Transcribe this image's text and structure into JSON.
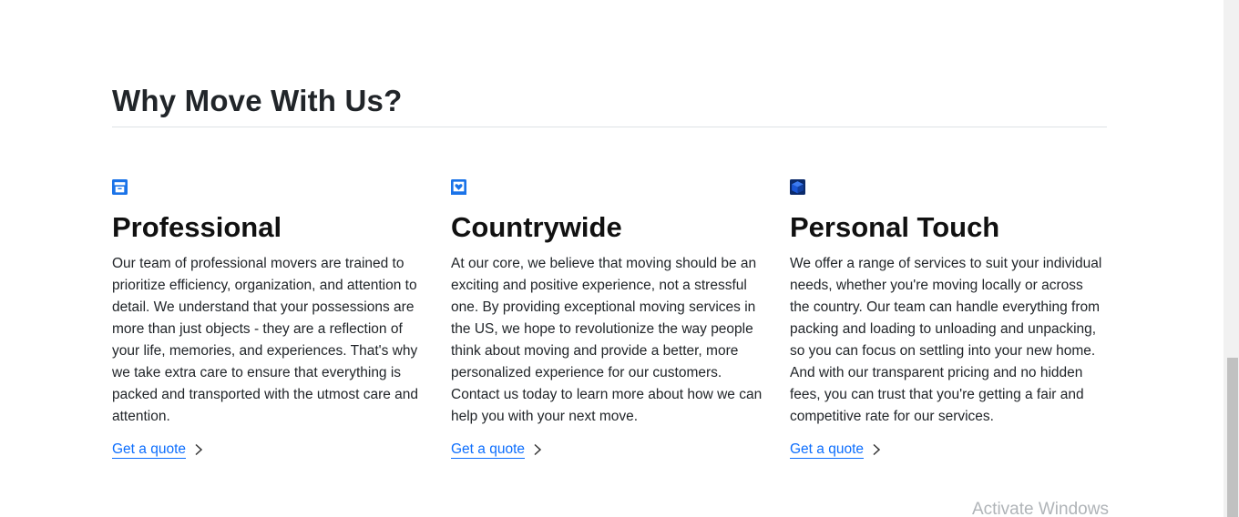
{
  "section": {
    "title": "Why Move With Us?"
  },
  "features": [
    {
      "icon": "archive-box-icon",
      "title": "Professional",
      "text": "Our team of professional movers are trained to prioritize efficiency, organization, and attention to detail. We understand that your possessions are more than just objects - they are a reflection of your life, memories, and experiences. That's why we take extra care to ensure that everything is packed and transported with the utmost care and attention.",
      "link_label": "Get a quote"
    },
    {
      "icon": "heart-box-icon",
      "title": "Countrywide",
      "text": "At our core, we believe that moving should be an exciting and positive experience, not a stressful one. By providing exceptional moving services in the US, we hope to revolutionize the way people think about moving and provide a better, more personalized experience for our customers. Contact us today to learn more about how we can help you with your next move.",
      "link_label": "Get a quote"
    },
    {
      "icon": "cube-icon",
      "title": "Personal Touch",
      "text": "We offer a range of services to suit your individual needs, whether you're moving locally or across the country. Our team can handle everything from packing and loading to unloading and unpacking, so you can focus on settling into your new home. And with our transparent pricing and no hidden fees, you can trust that you're getting a fair and competitive rate for our services.",
      "link_label": "Get a quote"
    }
  ],
  "watermark": {
    "text": "Activate Windows"
  },
  "colors": {
    "accent": "#0d6efd",
    "icon_blue": "#1a73e8",
    "text": "#212529"
  }
}
